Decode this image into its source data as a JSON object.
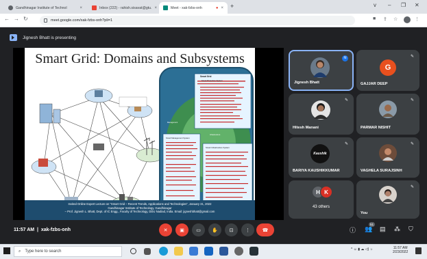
{
  "browser": {
    "tabs": [
      {
        "label": "Gandhinagar Institute of Technol",
        "color": "#5f6368"
      },
      {
        "label": "Inbox (222) - rahish.sisavat@gtu.",
        "color": "#ea4335"
      },
      {
        "label": "Meet - xak-fzbs-onh",
        "color": "#00897b",
        "active": true
      }
    ],
    "new_tab": "+",
    "url": "meet.google.com/xak-fzbs-onh?pli=1",
    "window_controls": [
      "v",
      "–",
      "❐",
      "✕"
    ]
  },
  "meet": {
    "presenting_text": "Jignesh Bhatt is presenting",
    "slide": {
      "title": "Smart Grid: Domains and Subsystems",
      "caption_line1": "Invited Online Expert Lecture on “Smart Grid – Recent Trends, Applications and Technologies”, January 31, 2022",
      "caption_line2": "Gandhinagar Institute of Technology, Gandhinagar",
      "caption_line3": "– Prof. Jignesh L. Bhatt, Dept. of IC Engg., Faculty of Technology, DDU Nadiad, India. Email: jigneshbhatt@gmail.com",
      "panel_title": "Smart Grid",
      "panel_label_mgmt": "Smart Management System",
      "panel_label_infra": "Smart Infrastructure System",
      "panel_label_prot": "Smart Protection System",
      "panel_label_mgmt_small": "Management",
      "panel_label_infra_small": "Infrastructure"
    },
    "participants": [
      {
        "name": "Jignesh Bhatt",
        "type": "photo",
        "speaking": true
      },
      {
        "name": "GAJJAR DEEP",
        "type": "initial",
        "initial": "G",
        "color": "#e8501e"
      },
      {
        "name": "Hitesh Manani",
        "type": "photo"
      },
      {
        "name": "PARMAR NISHIT",
        "type": "photo"
      },
      {
        "name": "BARIYA KAUSHIKKUMAR",
        "type": "logo",
        "logo_text": "Kaushik"
      },
      {
        "name": "VAGHELA SURAJSINH",
        "type": "photo"
      },
      {
        "name": "43 others",
        "type": "group",
        "initials": [
          "H",
          "K"
        ],
        "colors": [
          "#5f6368",
          "#d93025"
        ]
      },
      {
        "name": "You",
        "type": "photo"
      }
    ],
    "time": "11:57 AM",
    "meeting_code": "xak-fzbs-onh",
    "participant_badge": "51"
  },
  "taskbar": {
    "search_placeholder": "Type here to search",
    "clock_time": "11:57 AM",
    "clock_date": "2/23/2022",
    "tray_icons": "^ ☺ ▮ ☁ ◁) ☼"
  }
}
